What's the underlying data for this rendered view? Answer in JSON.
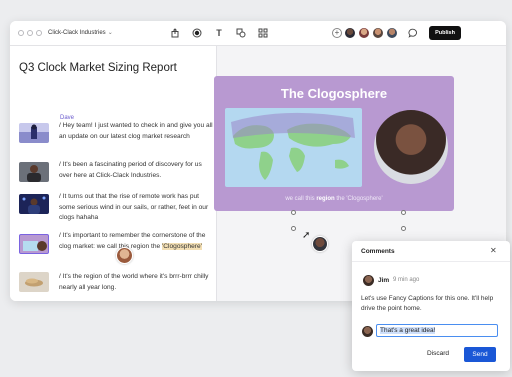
{
  "window": {
    "project_name": "Click-Clack Industries",
    "publish_label": "Publish"
  },
  "toolbar_icons": [
    "export-icon",
    "record-icon",
    "text-icon",
    "shapes-icon",
    "grid-icon",
    "add-collaborator-icon",
    "comment-icon"
  ],
  "document": {
    "title": "Q3 Clock Market Sizing Report",
    "speaker": "Dave",
    "lines": [
      "/ Hey team! I just wanted to check in and give you all an update on our latest clog market research",
      "/ It's been a fascinating period of discovery for us over here at Click-Clack Industries.",
      "/ It turns out that the rise of remote work has put some serious wind in our sails, or rather, feet in our clogs hahaha",
      "/ It's important to remember the cornerstone of the clog market: we call this region the",
      "/ It's the region of the world where it's brrr-brrr chilly nearly all year long."
    ],
    "highlight": "'Clogosphere'"
  },
  "slide": {
    "title": "The Clogosphere",
    "caption_pre": "we call this ",
    "caption_bold": "region",
    "caption_post": " the 'Clogosphere'"
  },
  "comments": {
    "title": "Comments",
    "author": "Jim",
    "time": "9 min ago",
    "message": "Let's use Fancy Captions for this one. It'll help drive the point home.",
    "reply_value": "That's a great idea!",
    "discard_label": "Discard",
    "send_label": "Send"
  },
  "colors": {
    "slide_bg": "#b899d1",
    "accent": "#6a5acd",
    "send": "#1a57d6",
    "publish": "#111111"
  }
}
